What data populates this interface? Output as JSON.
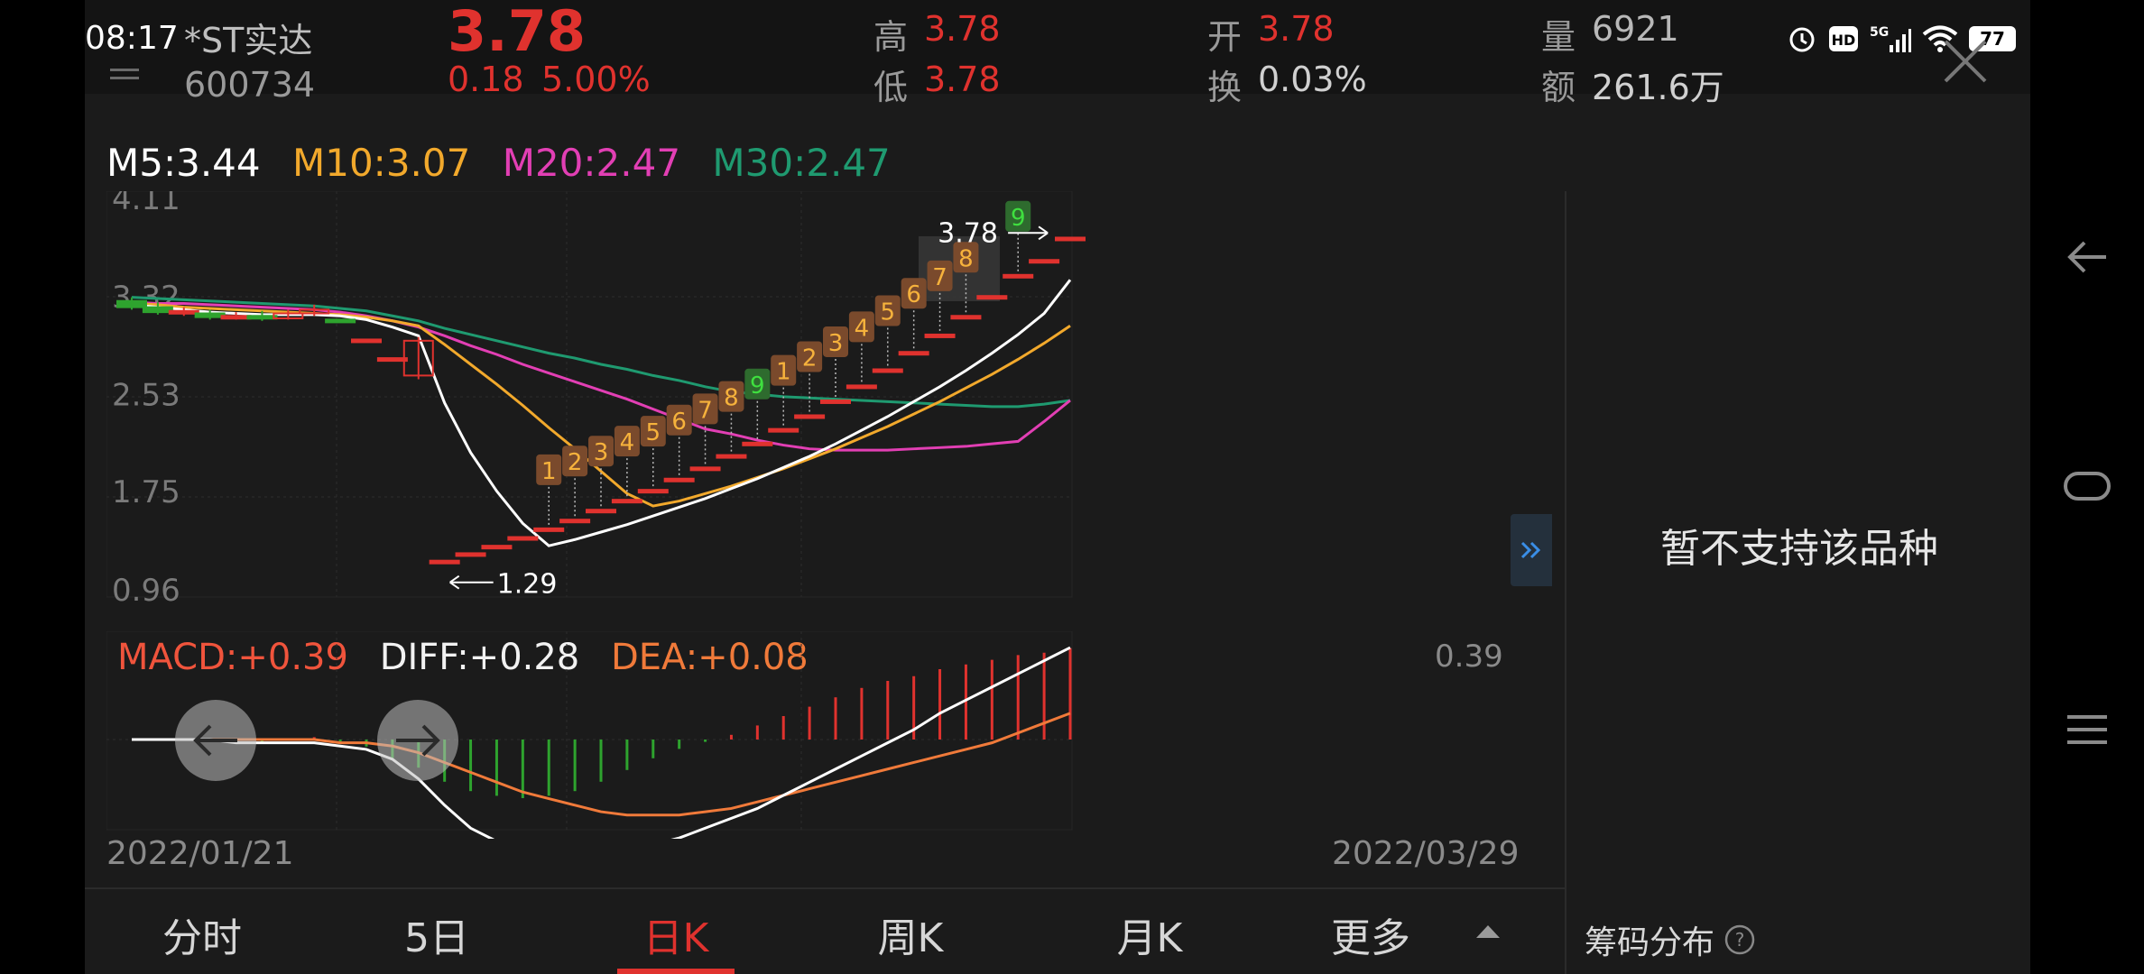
{
  "status_bar": {
    "time": "08:17",
    "battery": "77"
  },
  "stock": {
    "name": "*ST实达",
    "code": "600734",
    "price": "3.78",
    "change": "0.18",
    "change_pct": "5.00%",
    "high_label": "高",
    "high": "3.78",
    "low_label": "低",
    "low": "3.78",
    "open_label": "开",
    "open": "3.78",
    "turnover_label": "换",
    "turnover": "0.03%",
    "volume_label": "量",
    "volume": "6921",
    "amount_label": "额",
    "amount": "261.6万"
  },
  "ma_legend": {
    "m5": "M5:3.44",
    "m10": "M10:3.07",
    "m20": "M20:2.47",
    "m30": "M30:2.47"
  },
  "macd_legend": {
    "macd": "MACD:+0.39",
    "diff": "DIFF:+0.28",
    "dea": "DEA:+0.08"
  },
  "macd_axis_max": "0.39",
  "dates": {
    "start": "2022/01/21",
    "end": "2022/03/29"
  },
  "side_panel": {
    "unsupported_text": "暂不支持该品种",
    "chip_distribution": "筹码分布"
  },
  "tabs": [
    {
      "label": "分时"
    },
    {
      "label": "5日"
    },
    {
      "label": "日K",
      "active": true
    },
    {
      "label": "周K"
    },
    {
      "label": "月K"
    },
    {
      "label": "更多"
    }
  ],
  "colors": {
    "up": "#e0322e",
    "down": "#2ea32e",
    "ma5": "#ffffff",
    "ma10": "#f2a92c",
    "ma20": "#e23fb4",
    "ma30": "#1f9a70",
    "dea": "#f07a3a",
    "td_buy": "#7a4a2c",
    "td_sell": "#2e6b2e"
  },
  "chart_data": {
    "type": "candlestick",
    "y_ticks": [
      "4.11",
      "3.32",
      "2.53",
      "1.75",
      "0.96"
    ],
    "ylim": [
      0.96,
      4.11
    ],
    "annotations": {
      "low_mark": "1.29",
      "high_mark": "3.78"
    },
    "candles": [
      {
        "o": 3.27,
        "c": 3.22,
        "h": 3.3,
        "l": 3.2
      },
      {
        "o": 3.22,
        "c": 3.18,
        "h": 3.26,
        "l": 3.16
      },
      {
        "o": 3.18,
        "c": 3.19,
        "h": 3.22,
        "l": 3.15
      },
      {
        "o": 3.17,
        "c": 3.14,
        "h": 3.2,
        "l": 3.12
      },
      {
        "o": 3.14,
        "c": 3.15,
        "h": 3.18,
        "l": 3.12
      },
      {
        "o": 3.15,
        "c": 3.13,
        "h": 3.19,
        "l": 3.11
      },
      {
        "o": 3.13,
        "c": 3.17,
        "h": 3.2,
        "l": 3.12
      },
      {
        "o": 3.17,
        "c": 3.2,
        "h": 3.24,
        "l": 3.15
      },
      {
        "o": 3.12,
        "c": 3.11,
        "h": 3.12,
        "l": 3.11
      },
      {
        "o": 2.96,
        "c": 2.96,
        "h": 2.96,
        "l": 2.96
      },
      {
        "o": 2.81,
        "c": 2.81,
        "h": 2.81,
        "l": 2.81
      },
      {
        "o": 2.67,
        "c": 2.95,
        "h": 2.98,
        "l": 2.64
      },
      {
        "o": 1.18,
        "c": 1.18,
        "h": 1.18,
        "l": 1.18
      },
      {
        "o": 1.24,
        "c": 1.24,
        "h": 1.24,
        "l": 1.24
      },
      {
        "o": 1.3,
        "c": 1.3,
        "h": 1.3,
        "l": 1.3
      },
      {
        "o": 1.37,
        "c": 1.37,
        "h": 1.37,
        "l": 1.37
      },
      {
        "o": 1.44,
        "c": 1.44,
        "h": 1.44,
        "l": 1.44
      },
      {
        "o": 1.51,
        "c": 1.51,
        "h": 1.51,
        "l": 1.51
      },
      {
        "o": 1.59,
        "c": 1.59,
        "h": 1.59,
        "l": 1.59
      },
      {
        "o": 1.67,
        "c": 1.67,
        "h": 1.67,
        "l": 1.67
      },
      {
        "o": 1.75,
        "c": 1.75,
        "h": 1.75,
        "l": 1.75
      },
      {
        "o": 1.84,
        "c": 1.84,
        "h": 1.84,
        "l": 1.84
      },
      {
        "o": 1.93,
        "c": 1.93,
        "h": 1.93,
        "l": 1.93
      },
      {
        "o": 2.03,
        "c": 2.03,
        "h": 2.03,
        "l": 2.03
      },
      {
        "o": 2.13,
        "c": 2.13,
        "h": 2.13,
        "l": 2.13
      },
      {
        "o": 2.24,
        "c": 2.24,
        "h": 2.24,
        "l": 2.24
      },
      {
        "o": 2.35,
        "c": 2.35,
        "h": 2.35,
        "l": 2.35
      },
      {
        "o": 2.47,
        "c": 2.47,
        "h": 2.47,
        "l": 2.47
      },
      {
        "o": 2.59,
        "c": 2.59,
        "h": 2.59,
        "l": 2.59
      },
      {
        "o": 2.72,
        "c": 2.72,
        "h": 2.72,
        "l": 2.72
      },
      {
        "o": 2.86,
        "c": 2.86,
        "h": 2.86,
        "l": 2.86
      },
      {
        "o": 3.0,
        "c": 3.0,
        "h": 3.0,
        "l": 3.0
      },
      {
        "o": 3.15,
        "c": 3.15,
        "h": 3.15,
        "l": 3.15
      },
      {
        "o": 3.31,
        "c": 3.31,
        "h": 3.31,
        "l": 3.31
      },
      {
        "o": 3.48,
        "c": 3.48,
        "h": 3.48,
        "l": 3.48
      },
      {
        "o": 3.6,
        "c": 3.6,
        "h": 3.6,
        "l": 3.6
      },
      {
        "o": 3.78,
        "c": 3.78,
        "h": 3.78,
        "l": 3.78
      }
    ],
    "td_labels": [
      {
        "i": 16,
        "n": "1",
        "kind": "buy"
      },
      {
        "i": 17,
        "n": "2",
        "kind": "buy"
      },
      {
        "i": 18,
        "n": "3",
        "kind": "buy"
      },
      {
        "i": 19,
        "n": "4",
        "kind": "buy"
      },
      {
        "i": 20,
        "n": "5",
        "kind": "buy"
      },
      {
        "i": 21,
        "n": "6",
        "kind": "buy"
      },
      {
        "i": 22,
        "n": "7",
        "kind": "buy"
      },
      {
        "i": 23,
        "n": "8",
        "kind": "buy"
      },
      {
        "i": 24,
        "n": "9",
        "kind": "sell"
      },
      {
        "i": 25,
        "n": "1",
        "kind": "buy"
      },
      {
        "i": 26,
        "n": "2",
        "kind": "buy"
      },
      {
        "i": 27,
        "n": "3",
        "kind": "buy"
      },
      {
        "i": 28,
        "n": "4",
        "kind": "buy"
      },
      {
        "i": 29,
        "n": "5",
        "kind": "buy"
      },
      {
        "i": 30,
        "n": "6",
        "kind": "buy"
      },
      {
        "i": 31,
        "n": "7",
        "kind": "buy"
      },
      {
        "i": 32,
        "n": "8",
        "kind": "buy"
      },
      {
        "i": 34,
        "n": "9",
        "kind": "sell"
      }
    ],
    "ma5": [
      3.24,
      3.22,
      3.2,
      3.18,
      3.17,
      3.16,
      3.16,
      3.16,
      3.15,
      3.12,
      3.06,
      2.99,
      2.45,
      2.05,
      1.74,
      1.48,
      1.3,
      1.35,
      1.41,
      1.47,
      1.54,
      1.61,
      1.68,
      1.76,
      1.84,
      1.93,
      2.02,
      2.12,
      2.23,
      2.34,
      2.46,
      2.58,
      2.71,
      2.85,
      3.0,
      3.17,
      3.44
    ],
    "ma10": [
      3.25,
      3.24,
      3.22,
      3.21,
      3.2,
      3.19,
      3.18,
      3.17,
      3.16,
      3.14,
      3.11,
      3.07,
      2.92,
      2.76,
      2.6,
      2.43,
      2.25,
      2.08,
      1.9,
      1.72,
      1.62,
      1.66,
      1.72,
      1.78,
      1.85,
      1.92,
      2.0,
      2.08,
      2.17,
      2.26,
      2.36,
      2.46,
      2.57,
      2.68,
      2.8,
      2.93,
      3.07
    ],
    "ma20": [
      3.26,
      3.25,
      3.25,
      3.24,
      3.23,
      3.22,
      3.21,
      3.2,
      3.18,
      3.15,
      3.11,
      3.06,
      2.99,
      2.91,
      2.84,
      2.76,
      2.69,
      2.62,
      2.55,
      2.48,
      2.4,
      2.32,
      2.24,
      2.2,
      2.15,
      2.11,
      2.08,
      2.07,
      2.07,
      2.07,
      2.08,
      2.09,
      2.1,
      2.12,
      2.14,
      2.3,
      2.47
    ],
    "ma30": [
      3.3,
      3.29,
      3.28,
      3.27,
      3.26,
      3.25,
      3.24,
      3.23,
      3.21,
      3.19,
      3.15,
      3.11,
      3.05,
      3.0,
      2.95,
      2.9,
      2.85,
      2.81,
      2.76,
      2.72,
      2.67,
      2.63,
      2.58,
      2.54,
      2.52,
      2.5,
      2.49,
      2.48,
      2.47,
      2.46,
      2.45,
      2.44,
      2.43,
      2.42,
      2.42,
      2.44,
      2.47
    ],
    "macd_hist": [
      0.0,
      0.0,
      0.0,
      -0.01,
      -0.01,
      -0.01,
      0.0,
      0.01,
      -0.01,
      -0.03,
      -0.08,
      -0.12,
      -0.18,
      -0.22,
      -0.24,
      -0.25,
      -0.24,
      -0.22,
      -0.18,
      -0.13,
      -0.08,
      -0.04,
      -0.01,
      0.02,
      0.06,
      0.1,
      0.14,
      0.18,
      0.22,
      0.25,
      0.27,
      0.3,
      0.32,
      0.34,
      0.36,
      0.37,
      0.39
    ],
    "diff": [
      0.0,
      0.0,
      0.0,
      0.0,
      -0.01,
      -0.01,
      -0.01,
      -0.01,
      -0.02,
      -0.03,
      -0.06,
      -0.12,
      -0.2,
      -0.27,
      -0.31,
      -0.33,
      -0.34,
      -0.34,
      -0.34,
      -0.33,
      -0.32,
      -0.3,
      -0.27,
      -0.24,
      -0.21,
      -0.17,
      -0.13,
      -0.09,
      -0.05,
      -0.01,
      0.03,
      0.08,
      0.12,
      0.16,
      0.2,
      0.24,
      0.28
    ],
    "dea": [
      0.0,
      0.0,
      0.0,
      0.0,
      0.0,
      0.0,
      0.0,
      0.0,
      -0.01,
      -0.01,
      -0.02,
      -0.04,
      -0.07,
      -0.1,
      -0.13,
      -0.16,
      -0.18,
      -0.2,
      -0.22,
      -0.23,
      -0.23,
      -0.23,
      -0.22,
      -0.21,
      -0.19,
      -0.17,
      -0.15,
      -0.13,
      -0.11,
      -0.09,
      -0.07,
      -0.05,
      -0.03,
      -0.01,
      0.02,
      0.05,
      0.08
    ]
  }
}
